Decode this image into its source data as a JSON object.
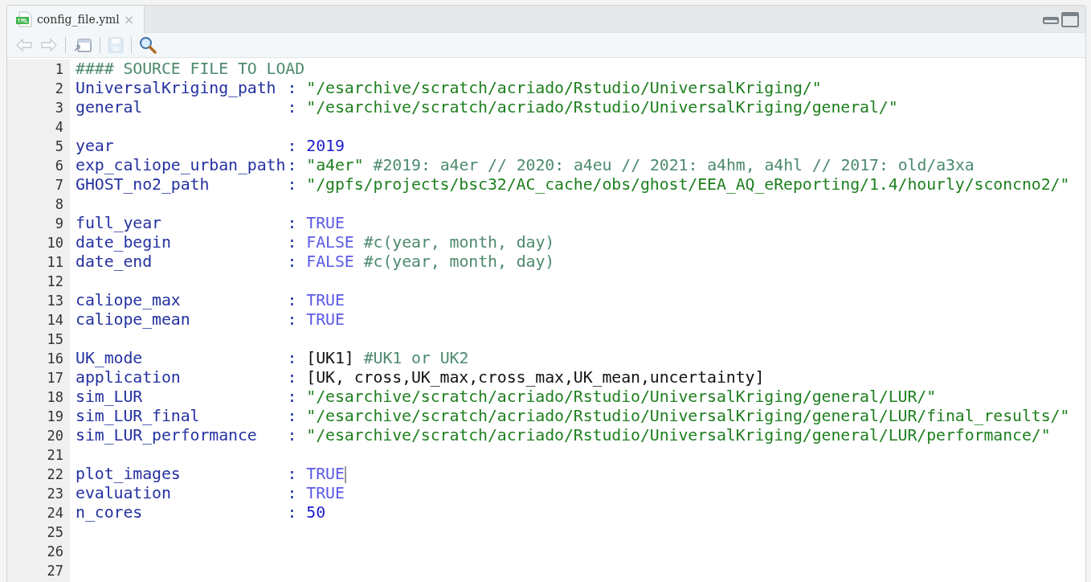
{
  "tabs": [
    {
      "label": "config_file.yml",
      "selected": true,
      "close": "×"
    }
  ],
  "toolbar": [
    {
      "kind": "back",
      "disabled": true
    },
    {
      "kind": "forward",
      "disabled": true
    },
    {
      "kind": "popout",
      "disabled": false
    },
    {
      "kind": "save",
      "disabled": true
    },
    {
      "kind": "search",
      "disabled": false
    }
  ],
  "lines": [
    {
      "number": "1",
      "tokens": [
        {
          "kind": "comment",
          "text": "#### SOURCE FILE TO LOAD"
        }
      ]
    },
    {
      "number": "2",
      "tokens": [
        {
          "kind": "key",
          "text": "UniversalKriging_path"
        },
        {
          "kind": "colon",
          "text": ":"
        },
        {
          "kind": "string",
          "text": "\"/esarchive/scratch/acriado/Rstudio/UniversalKriging/\""
        }
      ]
    },
    {
      "number": "3",
      "tokens": [
        {
          "kind": "key",
          "text": "general"
        },
        {
          "kind": "colon",
          "text": ":"
        },
        {
          "kind": "string",
          "text": "\"/esarchive/scratch/acriado/Rstudio/UniversalKriging/general/\""
        }
      ]
    },
    {
      "number": "4"
    },
    {
      "number": "5",
      "tokens": [
        {
          "kind": "key",
          "text": "year"
        },
        {
          "kind": "colon",
          "text": ":"
        },
        {
          "kind": "number",
          "text": "2019"
        }
      ]
    },
    {
      "number": "6",
      "tokens": [
        {
          "kind": "key",
          "text": "exp_caliope_urban_path"
        },
        {
          "kind": "colon",
          "text": ":"
        },
        {
          "kind": "string",
          "text": "\"a4er\""
        },
        {
          "kind": "comment",
          "text": "#2019: a4er // 2020: a4eu // 2021: a4hm, a4hl // 2017: old/a3xa"
        }
      ]
    },
    {
      "number": "7",
      "tokens": [
        {
          "kind": "key",
          "text": "GHOST_no2_path"
        },
        {
          "kind": "colon",
          "text": ":"
        },
        {
          "kind": "string",
          "text": "\"/gpfs/projects/bsc32/AC_cache/obs/ghost/EEA_AQ_eReporting/1.4/hourly/sconcno2/\""
        }
      ]
    },
    {
      "number": "8"
    },
    {
      "number": "9",
      "tokens": [
        {
          "kind": "key",
          "text": "full_year"
        },
        {
          "kind": "colon",
          "text": ":"
        },
        {
          "kind": "bool",
          "text": "TRUE"
        }
      ]
    },
    {
      "number": "10",
      "tokens": [
        {
          "kind": "key",
          "text": "date_begin"
        },
        {
          "kind": "colon",
          "text": ":"
        },
        {
          "kind": "bool",
          "text": "FALSE"
        },
        {
          "kind": "comment",
          "text": "#c(year, month, day)"
        }
      ]
    },
    {
      "number": "11",
      "tokens": [
        {
          "kind": "key",
          "text": "date_end"
        },
        {
          "kind": "colon",
          "text": ":"
        },
        {
          "kind": "bool",
          "text": "FALSE"
        },
        {
          "kind": "comment",
          "text": "#c(year, month, day)"
        }
      ]
    },
    {
      "number": "12"
    },
    {
      "number": "13",
      "tokens": [
        {
          "kind": "key",
          "text": "caliope_max"
        },
        {
          "kind": "colon",
          "text": ":"
        },
        {
          "kind": "bool",
          "text": "TRUE"
        }
      ]
    },
    {
      "number": "14",
      "tokens": [
        {
          "kind": "key",
          "text": "caliope_mean"
        },
        {
          "kind": "colon",
          "text": ":"
        },
        {
          "kind": "bool",
          "text": "TRUE"
        }
      ]
    },
    {
      "number": "15"
    },
    {
      "number": "16",
      "tokens": [
        {
          "kind": "key",
          "text": "UK_mode"
        },
        {
          "kind": "colon",
          "text": ":"
        },
        {
          "kind": "plain",
          "text": "[UK1]"
        },
        {
          "kind": "comment",
          "text": "#UK1 or UK2"
        }
      ]
    },
    {
      "number": "17",
      "tokens": [
        {
          "kind": "key",
          "text": "application"
        },
        {
          "kind": "colon",
          "text": ":"
        },
        {
          "kind": "plain",
          "text": "[UK, cross,UK_max,cross_max,UK_mean,uncertainty]"
        }
      ]
    },
    {
      "number": "18",
      "tokens": [
        {
          "kind": "key",
          "text": "sim_LUR"
        },
        {
          "kind": "colon",
          "text": ":"
        },
        {
          "kind": "string",
          "text": "\"/esarchive/scratch/acriado/Rstudio/UniversalKriging/general/LUR/\""
        }
      ]
    },
    {
      "number": "19",
      "tokens": [
        {
          "kind": "key",
          "text": "sim_LUR_final"
        },
        {
          "kind": "colon",
          "text": ":"
        },
        {
          "kind": "string",
          "text": "\"/esarchive/scratch/acriado/Rstudio/UniversalKriging/general/LUR/final_results/\""
        }
      ]
    },
    {
      "number": "20",
      "tokens": [
        {
          "kind": "key",
          "text": "sim_LUR_performance"
        },
        {
          "kind": "colon",
          "text": ":"
        },
        {
          "kind": "string",
          "text": "\"/esarchive/scratch/acriado/Rstudio/UniversalKriging/general/LUR/performance/\""
        }
      ]
    },
    {
      "number": "21"
    },
    {
      "number": "22",
      "tokens": [
        {
          "kind": "key",
          "text": "plot_images"
        },
        {
          "kind": "colon",
          "text": ":"
        },
        {
          "kind": "bool",
          "text": "TRUE"
        }
      ],
      "cursor": true
    },
    {
      "number": "23",
      "tokens": [
        {
          "kind": "key",
          "text": "evaluation"
        },
        {
          "kind": "colon",
          "text": ":"
        },
        {
          "kind": "bool",
          "text": "TRUE"
        }
      ]
    },
    {
      "number": "24",
      "tokens": [
        {
          "kind": "key",
          "text": "n_cores"
        },
        {
          "kind": "colon",
          "text": ":"
        },
        {
          "kind": "number",
          "text": "50"
        }
      ]
    },
    {
      "number": "25"
    },
    {
      "number": "26"
    },
    {
      "number": "27"
    }
  ]
}
